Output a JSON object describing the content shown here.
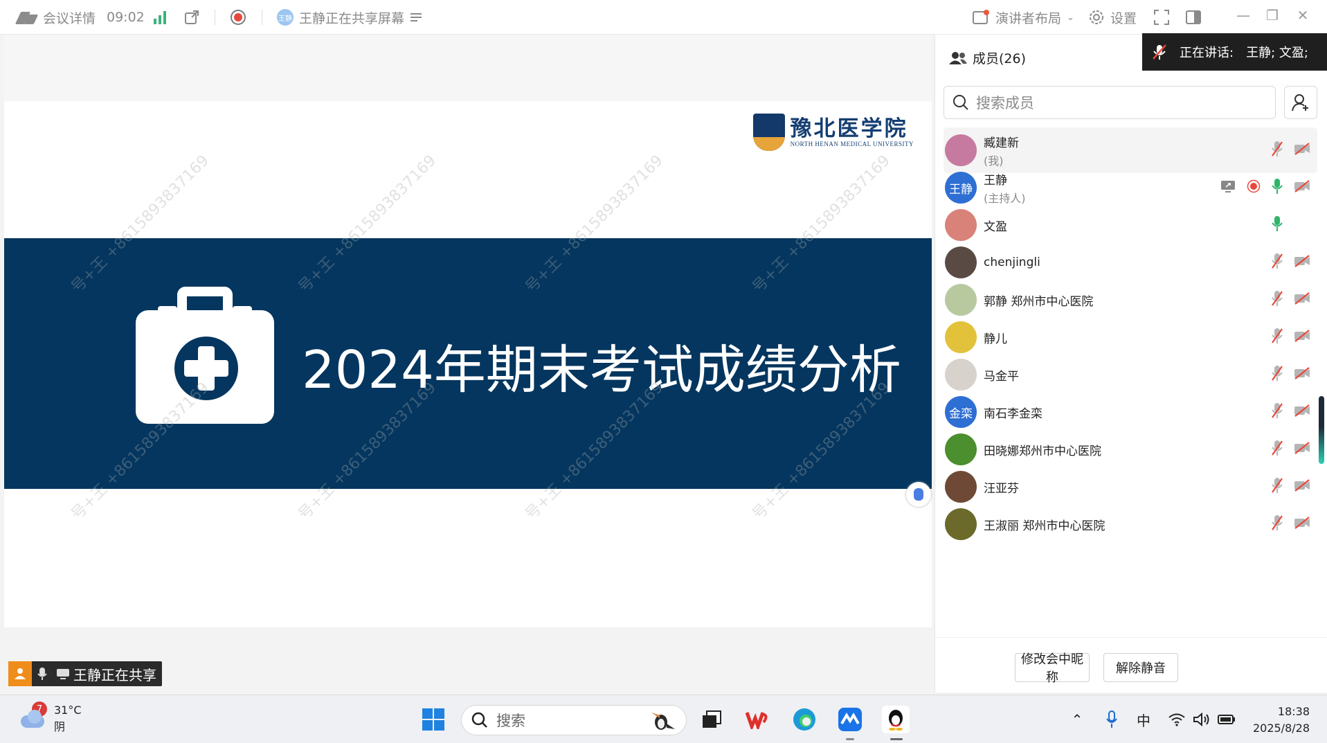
{
  "topbar": {
    "details": "会议详情",
    "timer": "09:02",
    "sharer_avatar": "王静",
    "sharing_status": "王静正在共享屏幕",
    "layout": "演讲者布局",
    "settings": "设置"
  },
  "speaking": {
    "label": "正在讲话:",
    "names": "王静; 文盈;"
  },
  "slide": {
    "logo_cn": "豫北医学院",
    "logo_en": "NORTH HENAN MEDICAL UNIVERSITY",
    "title": "2024年期末考试成绩分析",
    "watermark": "号+王 +8615893837169",
    "banner_color": "#04365f"
  },
  "sharer_tag": {
    "text": "王静正在共享"
  },
  "members": {
    "title": "成员(26)",
    "search_placeholder": "搜索成员",
    "list": [
      {
        "name": "臧建新",
        "role": "(我)",
        "avatar_color": "#c77aa0",
        "avatar_text": "",
        "mic": "muted",
        "cam": "off"
      },
      {
        "name": "王静",
        "role": "(主持人)",
        "avatar_color": "#2e6fd3",
        "avatar_text": "王静",
        "mic": "active",
        "cam": "off",
        "sharing": true,
        "recording": true
      },
      {
        "name": "文盈",
        "role": "",
        "avatar_color": "#d9827a",
        "avatar_text": "",
        "mic": "active",
        "cam": "none"
      },
      {
        "name": "chenjingli",
        "role": "",
        "avatar_color": "#5a4a44",
        "avatar_text": "",
        "mic": "muted",
        "cam": "off"
      },
      {
        "name": "郭静 郑州市中心医院",
        "role": "",
        "avatar_color": "#b8c9a0",
        "avatar_text": "",
        "mic": "muted",
        "cam": "off"
      },
      {
        "name": "静儿",
        "role": "",
        "avatar_color": "#e2c23a",
        "avatar_text": "",
        "mic": "muted",
        "cam": "off"
      },
      {
        "name": "马金平",
        "role": "",
        "avatar_color": "#d8d2cc",
        "avatar_text": "",
        "mic": "muted",
        "cam": "off"
      },
      {
        "name": "南石李金栾",
        "role": "",
        "avatar_color": "#2e6fd3",
        "avatar_text": "金栾",
        "mic": "muted",
        "cam": "off"
      },
      {
        "name": "田晓娜郑州市中心医院",
        "role": "",
        "avatar_color": "#4c8f2e",
        "avatar_text": "",
        "mic": "muted",
        "cam": "off"
      },
      {
        "name": "汪亚芬",
        "role": "",
        "avatar_color": "#6e4a36",
        "avatar_text": "",
        "mic": "muted",
        "cam": "off"
      },
      {
        "name": "王淑丽  郑州市中心医院",
        "role": "",
        "avatar_color": "#6b6a2a",
        "avatar_text": "",
        "mic": "muted",
        "cam": "off"
      }
    ],
    "rename_button": "修改会中昵称",
    "unmute_button": "解除静音"
  },
  "taskbar": {
    "weather_temp": "31°C",
    "weather_desc": "阴",
    "badge": "7",
    "search_placeholder": "搜索",
    "ime": "中",
    "time": "18:38",
    "date": "2025/8/28"
  }
}
